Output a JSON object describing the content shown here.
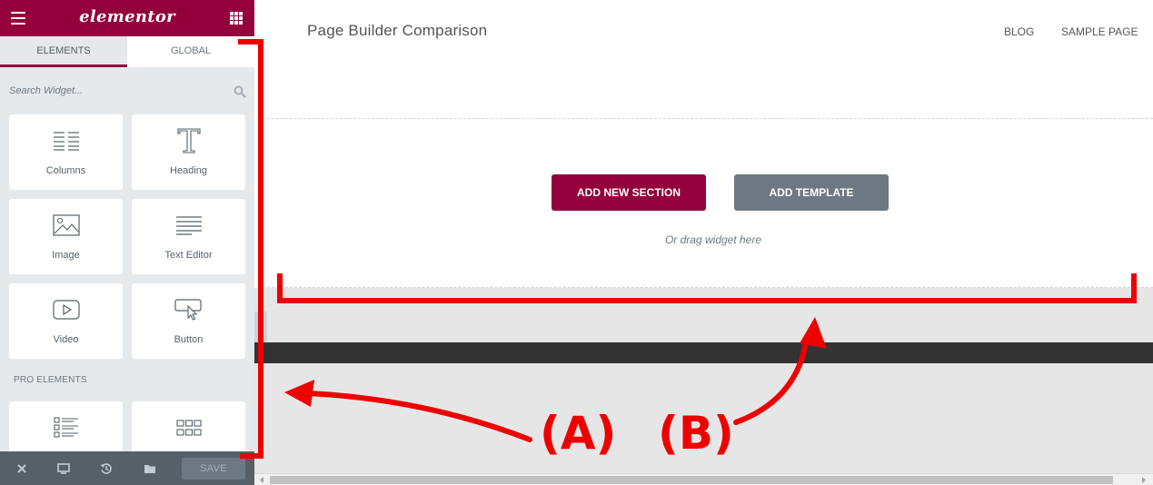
{
  "panel": {
    "logo": "elementor",
    "tabs": [
      {
        "label": "ELEMENTS"
      },
      {
        "label": "GLOBAL"
      }
    ],
    "search": {
      "placeholder": "Search Widget..."
    },
    "widgets": [
      {
        "label": "Columns",
        "icon": "columns-icon"
      },
      {
        "label": "Heading",
        "icon": "heading-icon"
      },
      {
        "label": "Image",
        "icon": "image-icon"
      },
      {
        "label": "Text Editor",
        "icon": "text-editor-icon"
      },
      {
        "label": "Video",
        "icon": "video-icon"
      },
      {
        "label": "Button",
        "icon": "button-icon"
      }
    ],
    "pro_section_title": "PRO ELEMENTS",
    "pro_widgets": [
      {
        "icon": "posts-icon"
      },
      {
        "icon": "portfolio-icon"
      }
    ],
    "footer": {
      "save_label": "SAVE"
    }
  },
  "preview": {
    "site_title": "Page Builder Comparison",
    "nav": [
      "BLOG",
      "SAMPLE PAGE"
    ],
    "add_section_label": "ADD NEW SECTION",
    "add_template_label": "ADD TEMPLATE",
    "drag_hint": "Or drag widget here"
  },
  "annotations": {
    "label_a": "(A)",
    "label_b": "(B)",
    "color": "#ee0000"
  },
  "colors": {
    "brand": "#93003c",
    "panel_bg": "#e6e9ec",
    "secondary_button": "#6d7882",
    "footer_bg": "#556068"
  }
}
